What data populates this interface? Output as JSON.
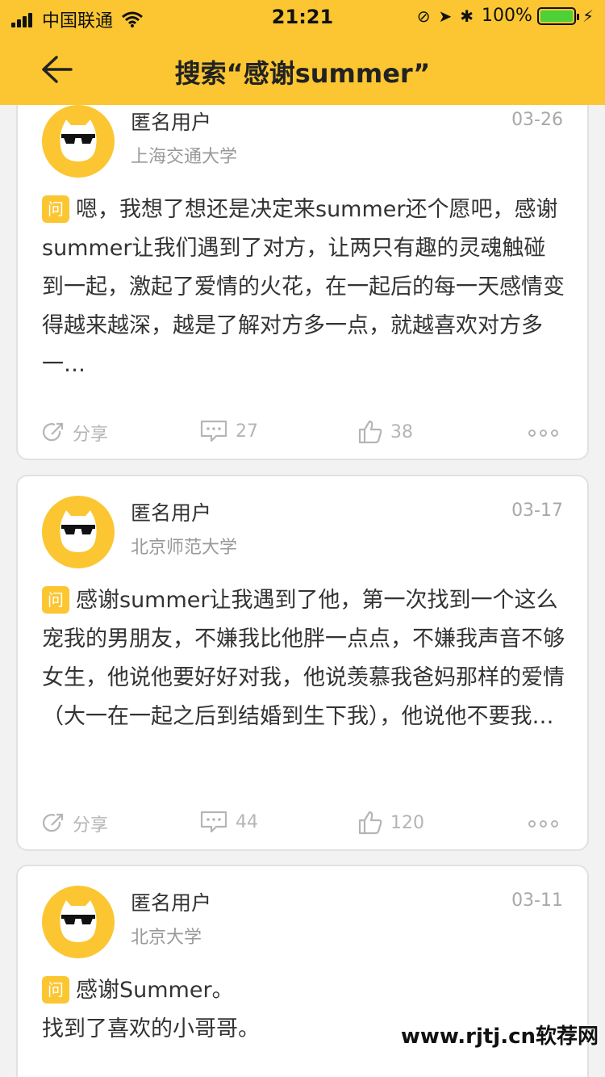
{
  "status_bar": {
    "carrier": "中国联通",
    "time": "21:21",
    "battery": "100%",
    "battery_level": 1.0
  },
  "nav": {
    "title": "搜索“感谢summer”"
  },
  "posts": [
    {
      "user": "匿名用户",
      "school": "上海交通大学",
      "date": "03-26",
      "badge": "问",
      "text": "嗯，我想了想还是决定来summer还个愿吧，感谢summer让我们遇到了对方，让两只有趣的灵魂触碰到一起，激起了爱情的火花，在一起后的每一天感情变得越来越深，越是了解对方多一点，就越喜欢对方多一…",
      "share_label": "分享",
      "comments": "27",
      "likes": "38"
    },
    {
      "user": "匿名用户",
      "school": "北京师范大学",
      "date": "03-17",
      "badge": "问",
      "text": "感谢summer让我遇到了他，第一次找到一个这么宠我的男朋友，不嫌我比他胖一点点，不嫌我声音不够女生，他说他要好好对我，他说羡慕我爸妈那样的爱情（大一在一起之后到结婚到生下我），他说他不要我…",
      "share_label": "分享",
      "comments": "44",
      "likes": "120"
    },
    {
      "user": "匿名用户",
      "school": "北京大学",
      "date": "03-11",
      "badge": "问",
      "text_line1": "感谢Summer。",
      "text_line2": "找到了喜欢的小哥哥。"
    }
  ],
  "watermark": "www.rjtj.cn软荐网",
  "colors": {
    "accent": "#fbc631",
    "battery": "#4cd137"
  }
}
